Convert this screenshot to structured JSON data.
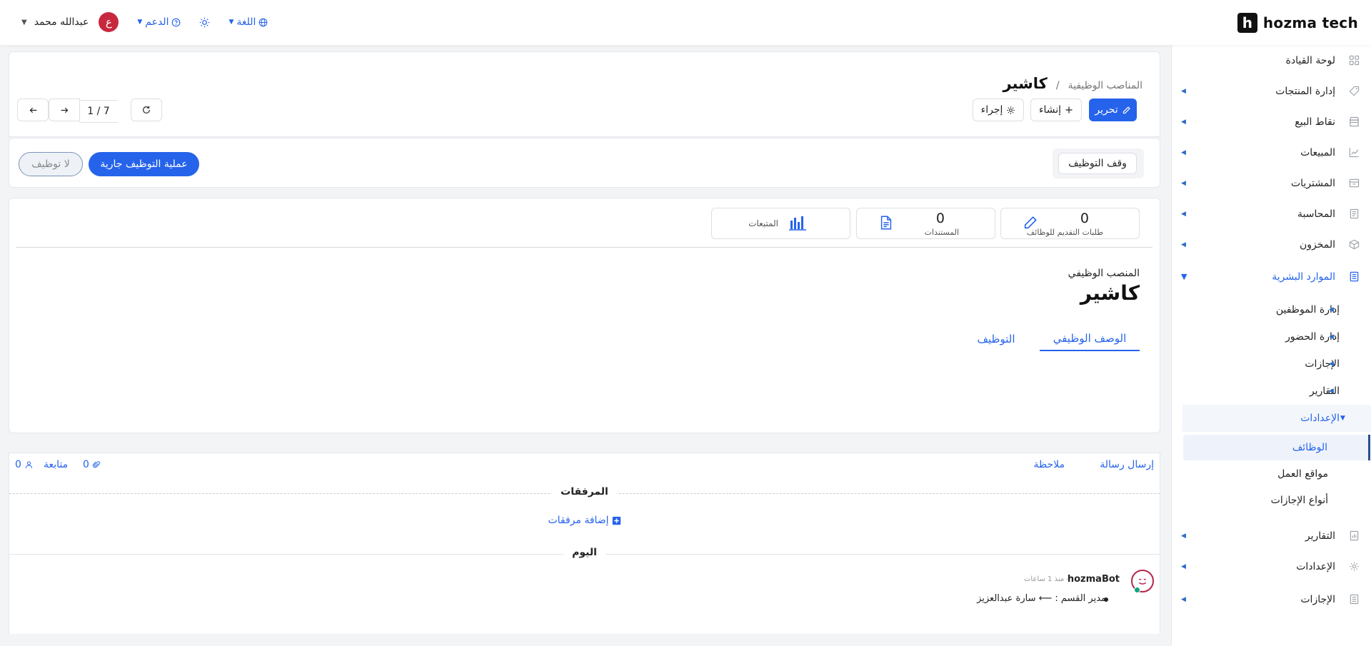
{
  "brand": {
    "logo_letter": "h",
    "name": "hozma tech"
  },
  "topbar": {
    "user_name": "عبدالله محمد",
    "avatar_letter": "ع",
    "support_label": "الدعم",
    "language_label": "اللغة"
  },
  "sidebar": {
    "items": [
      {
        "label": "لوحة القيادة",
        "icon": "dashboard-icon"
      },
      {
        "label": "إدارة المنتجات",
        "icon": "tag-icon"
      },
      {
        "label": "نقاط البيع",
        "icon": "store-icon"
      },
      {
        "label": "المبيعات",
        "icon": "chart-icon"
      },
      {
        "label": "المشتريات",
        "icon": "box-icon"
      },
      {
        "label": "المحاسبة",
        "icon": "ledger-icon"
      },
      {
        "label": "المخزون",
        "icon": "cube-icon"
      },
      {
        "label": "الموارد البشرية",
        "icon": "document-icon"
      }
    ],
    "hr_subitems": [
      {
        "label": "إدارة الموظفين"
      },
      {
        "label": "إدارة الحضور"
      },
      {
        "label": "الإجازات"
      },
      {
        "label": "التقارير"
      },
      {
        "label": "الإعدادات"
      }
    ],
    "settings_leaves": [
      {
        "label": "الوظائف"
      },
      {
        "label": "مواقع العمل"
      },
      {
        "label": "أنواع الإجازات"
      }
    ],
    "bottom_items": [
      {
        "label": "التقارير",
        "icon": "report-icon"
      },
      {
        "label": "الإعدادات",
        "icon": "gear-icon"
      },
      {
        "label": "الإجازات",
        "icon": "document-icon"
      }
    ]
  },
  "header": {
    "breadcrumb_parent": "المناصب الوظيفية",
    "breadcrumb_sep": "/",
    "title": "كاشير",
    "edit_label": "تحرير",
    "create_label": "إنشاء",
    "action_label": "إجراء",
    "pager": "1 / 7"
  },
  "status": {
    "stop_label": "وقف التوظيف",
    "active_label": "عملية التوظيف جارية",
    "idle_label": "لا توظيف"
  },
  "stats": [
    {
      "value": "0",
      "label": "طلبات التقديم للوظائف"
    },
    {
      "value": "0",
      "label": "المستندات"
    },
    {
      "label": "المتبعات"
    }
  ],
  "form": {
    "field_label": "المنصب الوظيفي",
    "field_value": "كاشير",
    "tabs": [
      {
        "label": "الوصف الوظيفي"
      },
      {
        "label": "التوظيف"
      }
    ]
  },
  "chatter": {
    "send_message": "إرسال رسالة",
    "note": "ملاحظة",
    "follow": "متابعة",
    "followers_count": "0",
    "attachments_count": "0",
    "attachments_title": "المرفقات",
    "add_attachments": "إضافة مرفقات",
    "today": "اليوم",
    "author": "hozmaBot",
    "time": "- منذ 1 ساعات",
    "message": "مدير القسم : ⟵ سارة عبدالعزيز"
  },
  "colors": {
    "accent": "#2563eb",
    "avatar": "#c8283e",
    "bot_ring": "#b3264b",
    "online": "#10a37f"
  }
}
